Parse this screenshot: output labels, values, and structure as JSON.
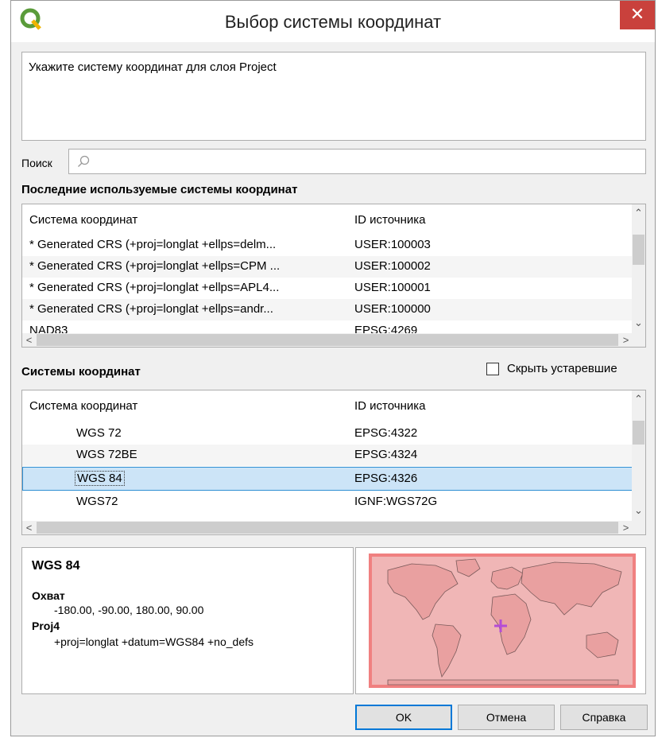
{
  "window": {
    "title": "Выбор системы координат",
    "close_glyph": "✕"
  },
  "description": "Укажите систему координат для слоя Project",
  "search": {
    "label": "Поиск",
    "placeholder": ""
  },
  "recent": {
    "title": "Последние используемые системы координат",
    "columns": [
      "Система координат",
      "ID источника"
    ],
    "rows": [
      {
        "name": "* Generated CRS (+proj=longlat +ellps=delm...",
        "id": "USER:100003"
      },
      {
        "name": "* Generated CRS (+proj=longlat +ellps=CPM ...",
        "id": "USER:100002"
      },
      {
        "name": "* Generated CRS (+proj=longlat +ellps=APL4...",
        "id": "USER:100001"
      },
      {
        "name": "* Generated CRS (+proj=longlat +ellps=andr...",
        "id": "USER:100000"
      },
      {
        "name": "NAD83",
        "id": "EPSG:4269"
      }
    ]
  },
  "crs": {
    "title": "Системы координат",
    "hide_deprecated_label": "Скрыть устаревшие",
    "hide_deprecated_checked": false,
    "columns": [
      "Система координат",
      "ID источника"
    ],
    "rows": [
      {
        "name": "WGS 72",
        "id": "EPSG:4322"
      },
      {
        "name": "WGS 72BE",
        "id": "EPSG:4324"
      },
      {
        "name": "WGS 84",
        "id": "EPSG:4326",
        "selected": true
      },
      {
        "name": "WGS72",
        "id": "IGNF:WGS72G"
      }
    ]
  },
  "info": {
    "title": "WGS 84",
    "extent_label": "Охват",
    "extent_value": "-180.00, -90.00, 180.00, 90.00",
    "proj_label": "Proj4",
    "proj_value": "+proj=longlat +datum=WGS84 +no_defs"
  },
  "buttons": {
    "ok": "OK",
    "cancel": "Отмена",
    "help": "Справка"
  },
  "colors": {
    "selection": "#cce4f7",
    "close": "#c9413c",
    "map_extent": "#f4a6a6",
    "marker": "#b44cd6"
  },
  "icons": [
    "qgis-logo-icon",
    "close-icon",
    "search-icon",
    "scroll-up-icon",
    "scroll-down-icon",
    "scroll-left-icon",
    "scroll-right-icon",
    "crosshair-marker-icon"
  ]
}
